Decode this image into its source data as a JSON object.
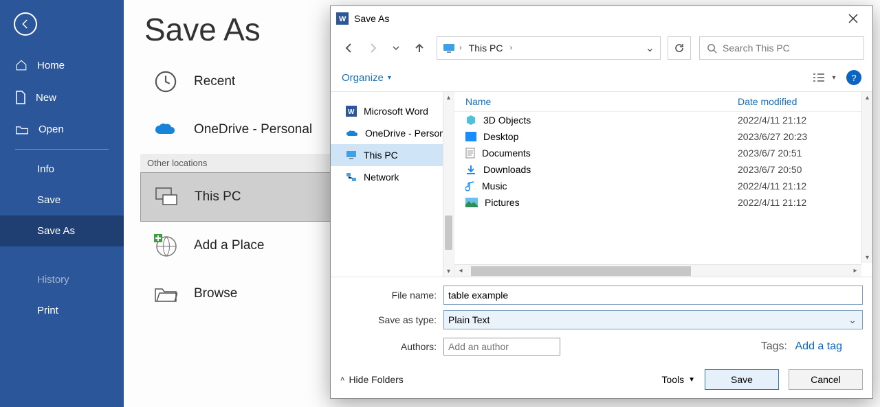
{
  "sidebar": {
    "home": "Home",
    "new": "New",
    "open": "Open",
    "info": "Info",
    "save": "Save",
    "save_as": "Save As",
    "history": "History",
    "print": "Print"
  },
  "backstage": {
    "title": "Save As",
    "recent": "Recent",
    "onedrive": "OneDrive - Personal",
    "other_locations": "Other locations",
    "this_pc": "This PC",
    "add_a_place": "Add a Place",
    "browse": "Browse"
  },
  "dialog": {
    "title": "Save As",
    "breadcrumb": {
      "root": "This PC"
    },
    "search_placeholder": "Search This PC",
    "organize": "Organize",
    "columns": {
      "name": "Name",
      "date": "Date modified"
    },
    "nav_pane": {
      "word": "Microsoft Word",
      "onedrive": "OneDrive - Person",
      "this_pc": "This PC",
      "network": "Network"
    },
    "files": [
      {
        "name": "3D Objects",
        "date": "2022/4/11 21:12",
        "icon": "cube"
      },
      {
        "name": "Desktop",
        "date": "2023/6/27 20:23",
        "icon": "desktop"
      },
      {
        "name": "Documents",
        "date": "2023/6/7 20:51",
        "icon": "doc"
      },
      {
        "name": "Downloads",
        "date": "2023/6/7 20:50",
        "icon": "download"
      },
      {
        "name": "Music",
        "date": "2022/4/11 21:12",
        "icon": "music"
      },
      {
        "name": "Pictures",
        "date": "2022/4/11 21:12",
        "icon": "picture"
      }
    ],
    "filename_label": "File name:",
    "filename_value": "table example",
    "savetype_label": "Save as type:",
    "savetype_value": "Plain Text",
    "authors_label": "Authors:",
    "authors_placeholder": "Add an author",
    "tags_label": "Tags:",
    "tags_link": "Add a tag",
    "hide_folders": "Hide Folders",
    "tools": "Tools",
    "save_btn": "Save",
    "cancel_btn": "Cancel"
  }
}
